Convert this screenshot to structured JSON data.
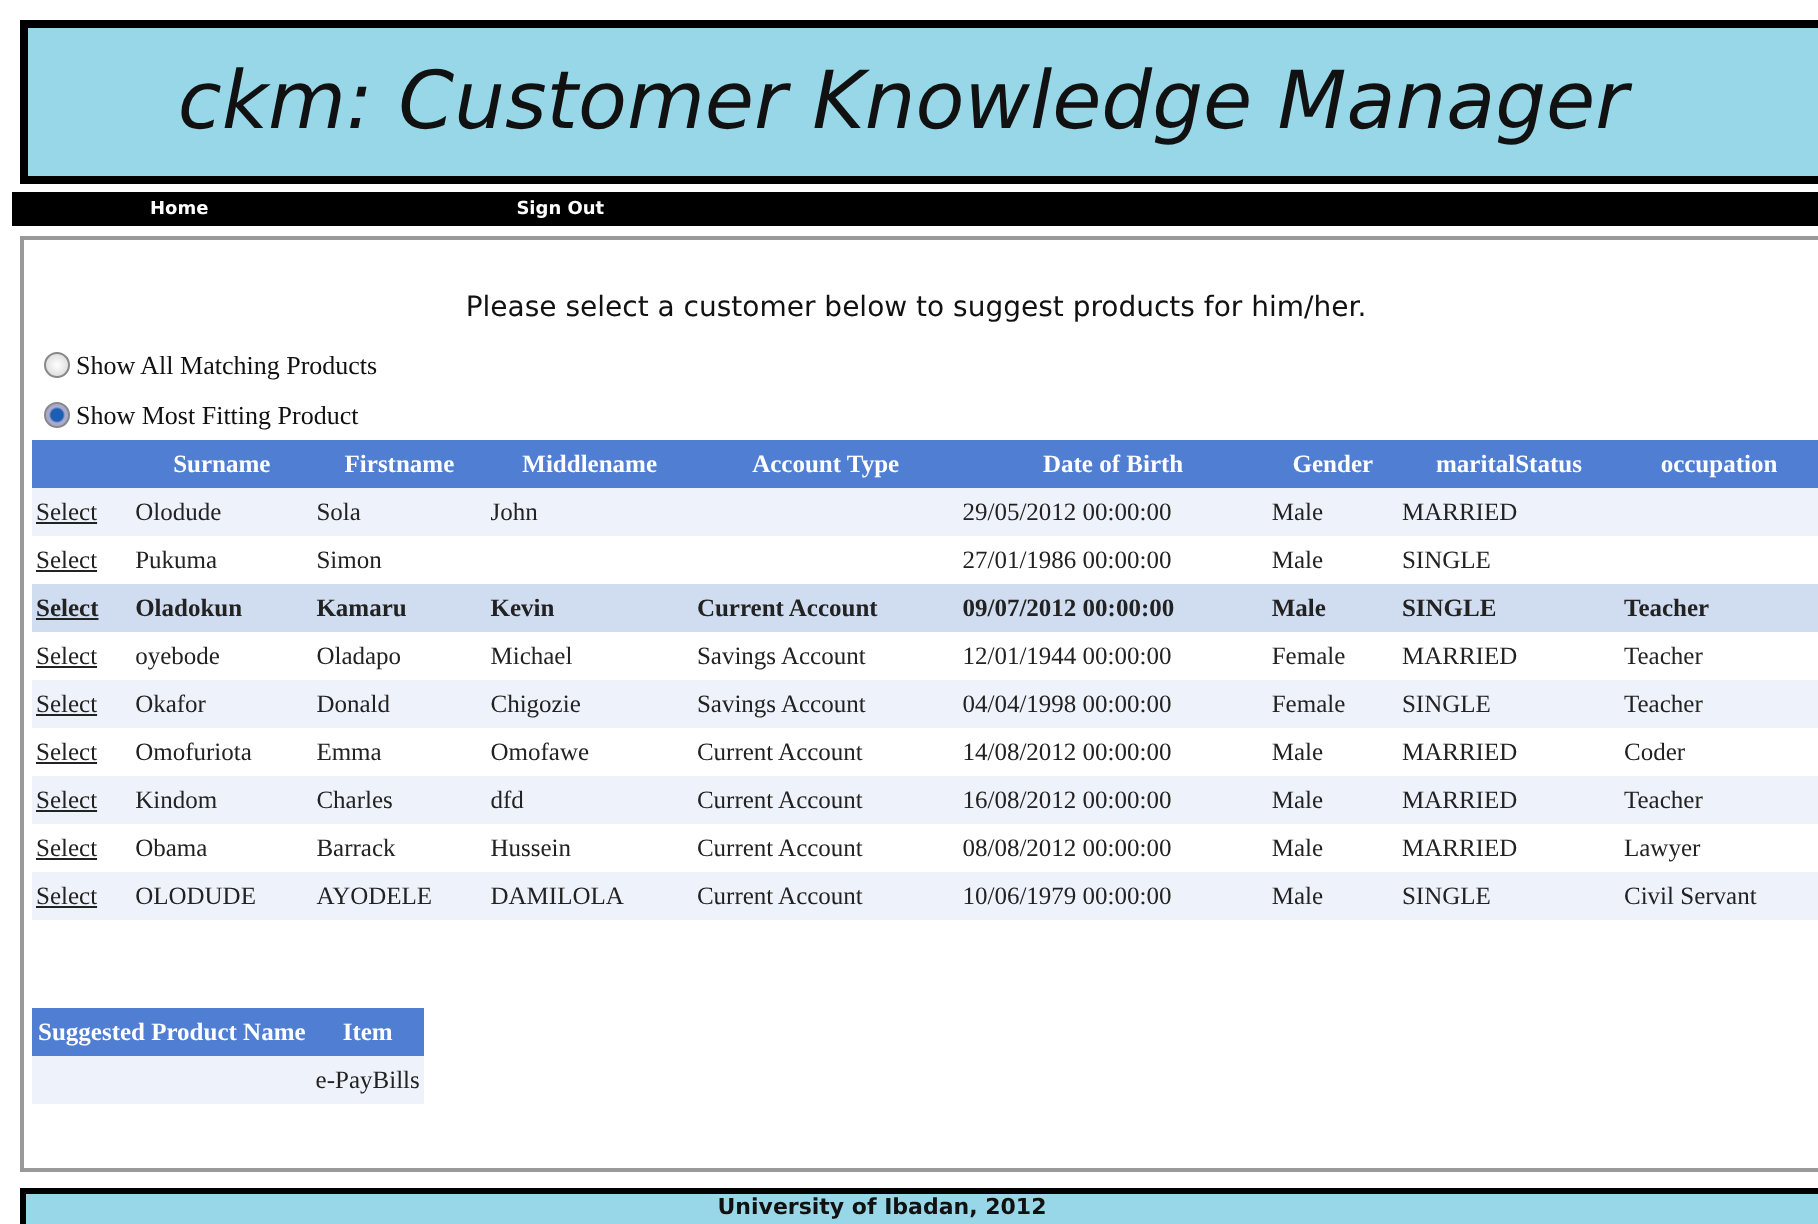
{
  "header": {
    "title": "ckm: Customer Knowledge Manager"
  },
  "nav": [
    "Home",
    "Sign Out"
  ],
  "instruction": "Please select a customer below to suggest products for him/her.",
  "options": [
    {
      "label": "Show All Matching Products",
      "selected": false
    },
    {
      "label": "Show Most Fitting Product",
      "selected": true
    }
  ],
  "customers": {
    "columns": [
      "",
      "Surname",
      "Firstname",
      "Middlename",
      "Account Type",
      "Date of Birth",
      "Gender",
      "maritalStatus",
      "occupation"
    ],
    "rows": [
      {
        "cells": [
          "Select",
          "Olodude",
          "Sola",
          "John",
          "",
          "29/05/2012 00:00:00",
          "Male",
          "MARRIED",
          ""
        ],
        "selected": false
      },
      {
        "cells": [
          "Select",
          "Pukuma",
          "Simon",
          "",
          "",
          "27/01/1986 00:00:00",
          "Male",
          "SINGLE",
          ""
        ],
        "selected": false
      },
      {
        "cells": [
          "Select",
          "Oladokun",
          "Kamaru",
          "Kevin",
          "Current Account",
          "09/07/2012 00:00:00",
          "Male",
          "SINGLE",
          "Teacher"
        ],
        "selected": true
      },
      {
        "cells": [
          "Select",
          "oyebode",
          "Oladapo",
          "Michael",
          "Savings Account",
          "12/01/1944 00:00:00",
          "Female",
          "MARRIED",
          "Teacher"
        ],
        "selected": false
      },
      {
        "cells": [
          "Select",
          "Okafor",
          "Donald",
          "Chigozie",
          "Savings Account",
          "04/04/1998 00:00:00",
          "Female",
          "SINGLE",
          "Teacher"
        ],
        "selected": false
      },
      {
        "cells": [
          "Select",
          "Omofuriota",
          "Emma",
          "Omofawe",
          "Current Account",
          "14/08/2012 00:00:00",
          "Male",
          "MARRIED",
          "Coder"
        ],
        "selected": false
      },
      {
        "cells": [
          "Select",
          "Kindom",
          "Charles",
          "dfd",
          "Current Account",
          "16/08/2012 00:00:00",
          "Male",
          "MARRIED",
          "Teacher"
        ],
        "selected": false
      },
      {
        "cells": [
          "Select",
          "Obama",
          "Barrack",
          "Hussein",
          "Current Account",
          "08/08/2012 00:00:00",
          "Male",
          "MARRIED",
          "Lawyer"
        ],
        "selected": false
      },
      {
        "cells": [
          "Select",
          "OLODUDE",
          "AYODELE",
          "DAMILOLA",
          "Current Account",
          "10/06/1979 00:00:00",
          "Male",
          "SINGLE",
          "Civil Servant"
        ],
        "selected": false
      }
    ]
  },
  "suggestions": {
    "columns": [
      "Suggested Product Name",
      "Item"
    ],
    "rows": [
      [
        "",
        "e-PayBills"
      ]
    ]
  },
  "footer": "University of Ibadan, 2012"
}
